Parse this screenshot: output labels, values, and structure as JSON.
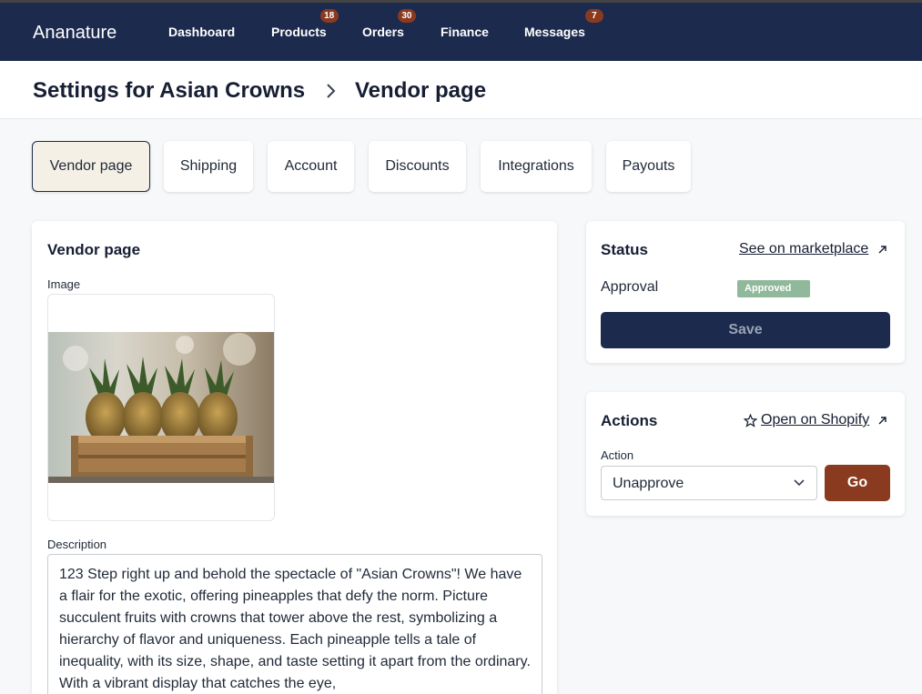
{
  "app": {
    "brand": "Ananature"
  },
  "nav": {
    "items": [
      {
        "label": "Dashboard",
        "badge": ""
      },
      {
        "label": "Products",
        "badge": "18"
      },
      {
        "label": "Orders",
        "badge": "30"
      },
      {
        "label": "Finance",
        "badge": ""
      },
      {
        "label": "Messages",
        "badge": "7"
      }
    ]
  },
  "header": {
    "crumb_parent": "Settings for Asian Crowns",
    "crumb_current": "Vendor page"
  },
  "tabs": [
    {
      "label": "Vendor page",
      "active": true
    },
    {
      "label": "Shipping"
    },
    {
      "label": "Account"
    },
    {
      "label": "Discounts"
    },
    {
      "label": "Integrations"
    },
    {
      "label": "Payouts"
    }
  ],
  "vendor_card": {
    "title": "Vendor page",
    "image_label": "Image",
    "image_icon": "pineapples-in-crate-photo",
    "description_label": "Description",
    "description": "123 Step right up and behold the spectacle of \"Asian Crowns\"! We have a flair for the exotic, offering pineapples that defy the norm. Picture succulent fruits with crowns that tower above the rest, symbolizing a hierarchy of flavor and uniqueness. Each pineapple tells a tale of inequality, with its size, shape, and taste setting it apart from the ordinary. With a vibrant display that catches the eye,"
  },
  "status_card": {
    "title": "Status",
    "marketplace_link": "See on marketplace",
    "approval_label": "Approval",
    "approval_value": "Approved",
    "approval_color": "#8fb99a",
    "save_label": "Save"
  },
  "actions_card": {
    "title": "Actions",
    "shopify_link": "Open on Shopify",
    "action_label": "Action",
    "action_value": "Unapprove",
    "go_label": "Go"
  },
  "colors": {
    "navbar": "#1c2a4d",
    "badge": "#8a3a1f",
    "go_button": "#8a3a1f",
    "active_tab_bg": "#f4f0e6"
  }
}
